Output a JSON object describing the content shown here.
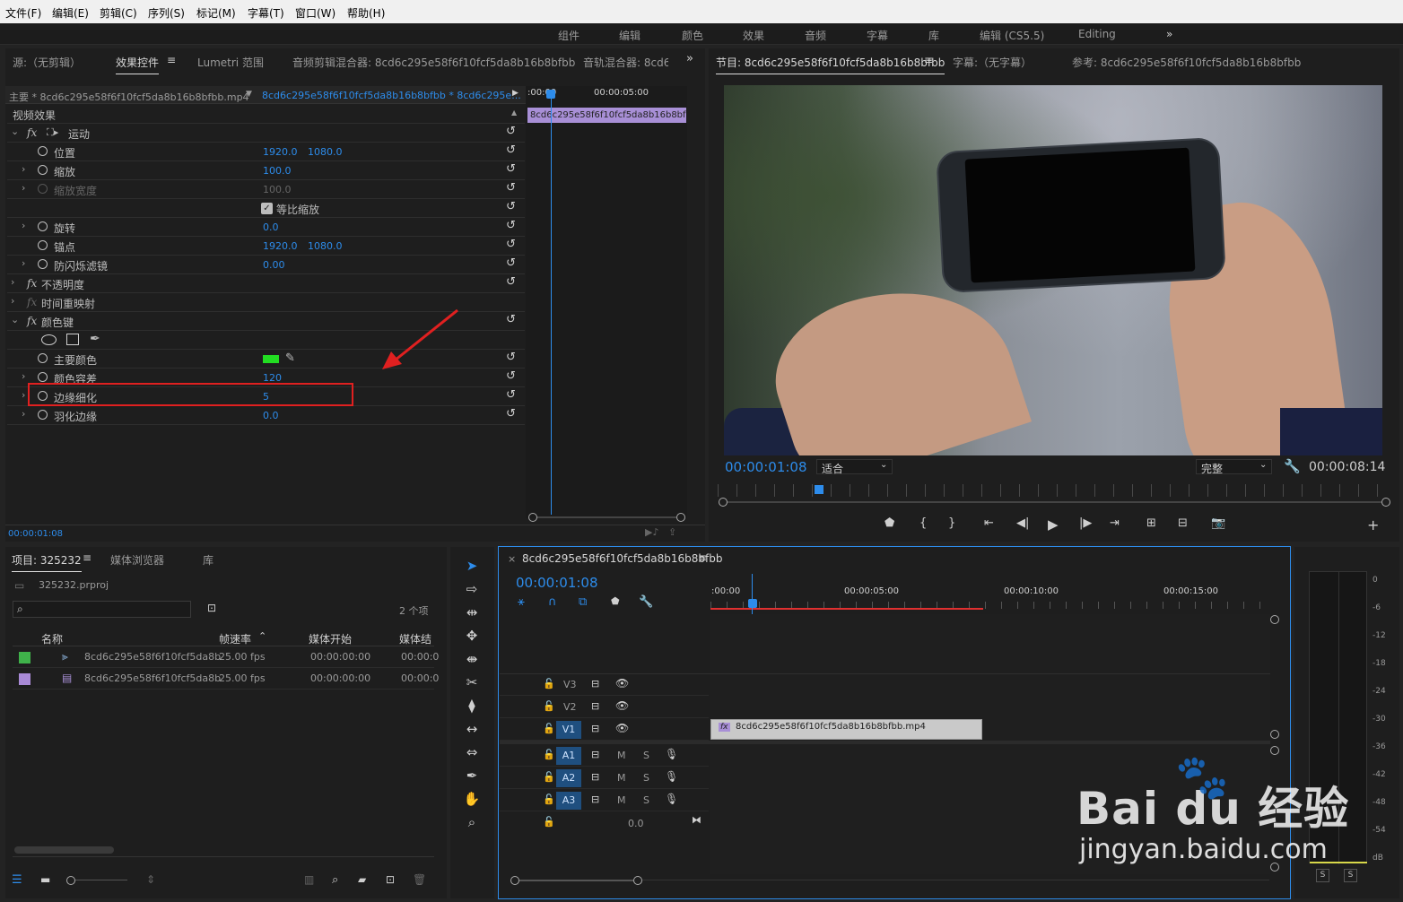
{
  "menu": [
    "文件(F)",
    "编辑(E)",
    "剪辑(C)",
    "序列(S)",
    "标记(M)",
    "字幕(T)",
    "窗口(W)",
    "帮助(H)"
  ],
  "workspaces": [
    "组件",
    "编辑",
    "颜色",
    "效果",
    "音频",
    "字幕",
    "库",
    "编辑 (CS5.5)",
    "Editing"
  ],
  "workspace_more": "»",
  "left_tabs": [
    "源:（无剪辑）",
    "效果控件",
    "Lumetri 范围",
    "音频剪辑混合器: 8cd6c295e58f6f10fcf5da8b16b8bfbb",
    "音轨混合器: 8cd6"
  ],
  "ec": {
    "master": "主要 * 8cd6c295e58f6f10fcf5da8b16b8bfbb.mp4",
    "seq": "8cd6c295e58f6f10fcf5da8b16b8bfbb * 8cd6c295e...",
    "t0": ":00:00",
    "t1": "00:00:05:00",
    "clip": "8cd6c295e58f6f10fcf5da8b16b8bf",
    "section": "视频效果",
    "motion": "运动",
    "pos": "位置",
    "pos_x": "1920.0",
    "pos_y": "1080.0",
    "scale": "缩放",
    "scale_v": "100.0",
    "scale_w": "缩放宽度",
    "scale_w_v": "100.0",
    "uniform": "等比缩放",
    "rotate": "旋转",
    "rotate_v": "0.0",
    "anchor": "锚点",
    "anchor_x": "1920.0",
    "anchor_y": "1080.0",
    "flicker": "防闪烁滤镜",
    "flicker_v": "0.00",
    "opacity": "不透明度",
    "timeremap": "时间重映射",
    "colorkey": "颜色键",
    "keycolor": "主要颜色",
    "keycolor_hex": "#22dd22",
    "tolerance": "颜色容差",
    "tolerance_v": "120",
    "edge": "边缘细化",
    "edge_v": "5",
    "feather": "羽化边缘",
    "feather_v": "0.0",
    "timecode": "00:00:01:08"
  },
  "program": {
    "tabs": [
      "节目: 8cd6c295e58f6f10fcf5da8b16b8bfbb",
      "字幕:（无字幕）",
      "参考: 8cd6c295e58f6f10fcf5da8b16b8bfbb"
    ],
    "timecode": "00:00:01:08",
    "fit": "适合",
    "quality": "完整",
    "duration": "00:00:08:14"
  },
  "project": {
    "tabs": [
      "项目: 325232",
      "媒体浏览器",
      "库"
    ],
    "file": "325232.prproj",
    "count": "2 个项",
    "cols": [
      "名称",
      "帧速率",
      "媒体开始",
      "媒体结"
    ],
    "rows": [
      {
        "color": "#3fb24a",
        "name": "8cd6c295e58f6f10fcf5da8b",
        "fps": "25.00 fps",
        "start": "00:00:00:00",
        "end": "00:00:0"
      },
      {
        "color": "#a98ad6",
        "name": "8cd6c295e58f6f10fcf5da8b",
        "fps": "25.00 fps",
        "start": "00:00:00:00",
        "end": "00:00:0"
      }
    ]
  },
  "timeline": {
    "title": "8cd6c295e58f6f10fcf5da8b16b8bfbb",
    "close": "×",
    "timecode": "00:00:01:08",
    "ruler": [
      ":00:00",
      "00:00:05:00",
      "00:00:10:00",
      "00:00:15:00"
    ],
    "tracks": [
      "V3",
      "V2",
      "V1",
      "A1",
      "A2",
      "A3"
    ],
    "m": "M",
    "s": "S",
    "vol": "0.0",
    "clip": "8cd6c295e58f6f10fcf5da8b16b8bfbb.mp4"
  },
  "meter": {
    "scale": [
      "0",
      "-6",
      "-12",
      "-18",
      "-24",
      "-30",
      "-36",
      "-42",
      "-48",
      "-54",
      "dB"
    ],
    "s": "S"
  },
  "watermark": {
    "brand": "Bai du 经验",
    "url": "jingyan.baidu.com"
  }
}
